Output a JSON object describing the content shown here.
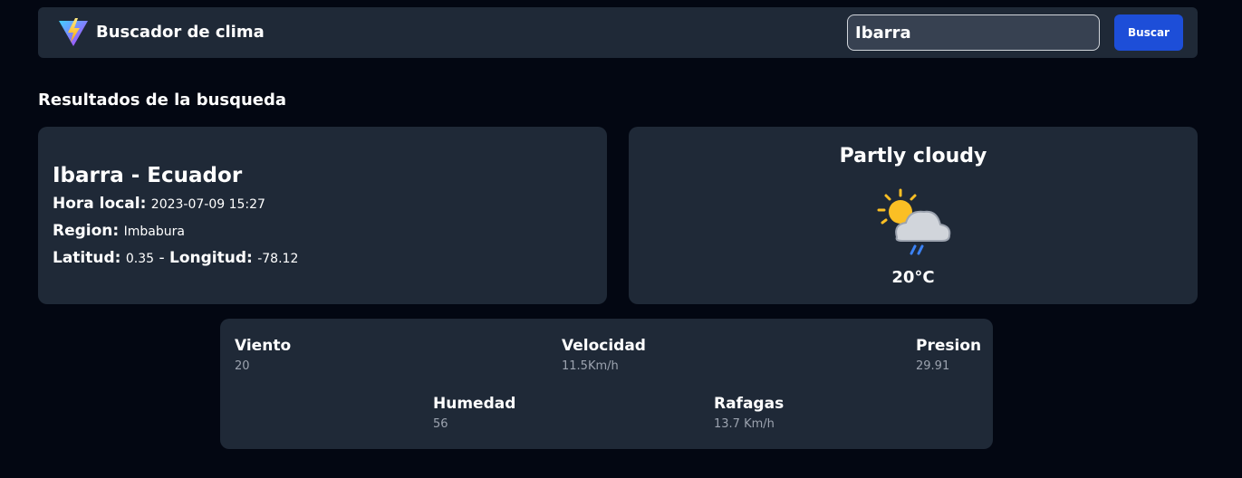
{
  "header": {
    "app_title": "Buscador de clima",
    "search_value": "Ibarra",
    "search_button": "Buscar",
    "logo_icon": "vite-logo-icon"
  },
  "results": {
    "section_title": "Resultados de la busqueda"
  },
  "location": {
    "city_line": "Ibarra - Ecuador",
    "local_time_label": "Hora local:",
    "local_time_value": "2023-07-09 15:27",
    "region_label": "Region:",
    "region_value": "Imbabura",
    "lat_label": "Latitud:",
    "lat_value": "0.35",
    "separator": "-",
    "lon_label": "Longitud:",
    "lon_value": "-78.12"
  },
  "weather": {
    "condition": "Partly cloudy",
    "icon": "partly-cloudy-rain-icon",
    "temperature": "20°C"
  },
  "details": {
    "wind_label": "Viento",
    "wind_value": "20",
    "speed_label": "Velocidad",
    "speed_value": "11.5Km/h",
    "pressure_label": "Presion",
    "pressure_value": "29.91",
    "humidity_label": "Humedad",
    "humidity_value": "56",
    "gusts_label": "Rafagas",
    "gusts_value": "13.7 Km/h"
  },
  "colors": {
    "background": "#030712",
    "card": "#1f2937",
    "accent_button": "#1d4ed8",
    "muted_text": "#9ca3af"
  }
}
